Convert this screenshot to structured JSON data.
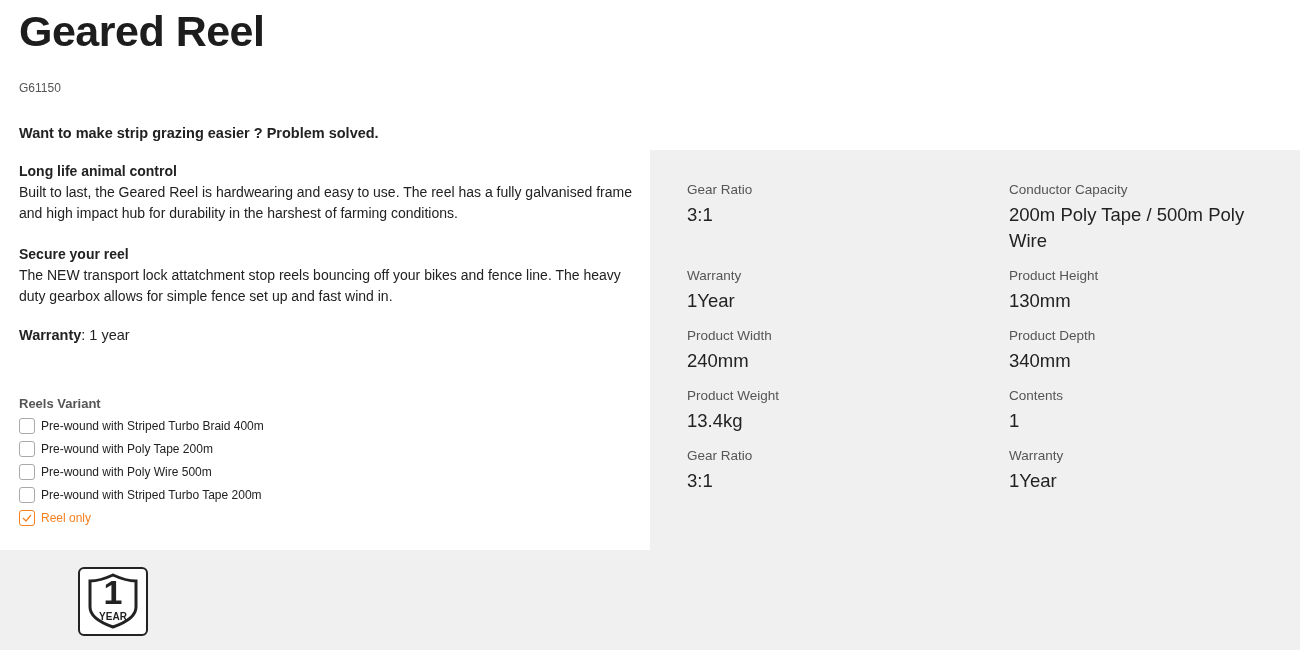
{
  "product": {
    "title": "Geared Reel",
    "sku": "G61150"
  },
  "description": [
    {
      "kind": "lead",
      "text": "Want to make strip grazing easier ? Problem solved."
    },
    {
      "kind": "section",
      "heading": "Long life animal control",
      "text": "Built to last, the Geared Reel is hardwearing and easy to use. The reel has a fully galvanised frame and high impact hub for durability in the harshest of farming conditions."
    },
    {
      "kind": "section",
      "heading": "Secure your reel",
      "text": "The NEW transport lock attatchment stop reels bouncing off your bikes and fence line. The heavy duty gearbox allows for simple fence set up and fast wind in."
    },
    {
      "kind": "note",
      "text": "**Warranty**: 1 year"
    }
  ],
  "variants": {
    "label": "Reels Variant",
    "options": [
      {
        "label": "Pre-wound with Striped Turbo Braid 400m",
        "checked": false
      },
      {
        "label": "Pre-wound with Poly Tape 200m",
        "checked": false
      },
      {
        "label": "Pre-wound with Poly Wire 500m",
        "checked": false
      },
      {
        "label": "Pre-wound with Striped Turbo Tape 200m",
        "checked": false
      },
      {
        "label": "Reel only",
        "checked": true
      }
    ]
  },
  "specs": [
    {
      "label": "Gear Ratio",
      "value": "3:1"
    },
    {
      "label": "Conductor Capacity",
      "value": "200m Poly Tape / 500m Poly Wire"
    },
    {
      "label": "Warranty",
      "value": "1Year"
    },
    {
      "label": "Product Height",
      "value": "130mm"
    },
    {
      "label": "Product Width",
      "value": "240mm"
    },
    {
      "label": "Product Depth",
      "value": "340mm"
    },
    {
      "label": "Product Weight",
      "value": "13.4kg"
    },
    {
      "label": "Contents",
      "value": "1"
    },
    {
      "label": "Gear Ratio",
      "value": "3:1"
    },
    {
      "label": "Warranty",
      "value": "1Year"
    }
  ],
  "warranty_badge": {
    "number": "1",
    "unit": "YEAR"
  }
}
